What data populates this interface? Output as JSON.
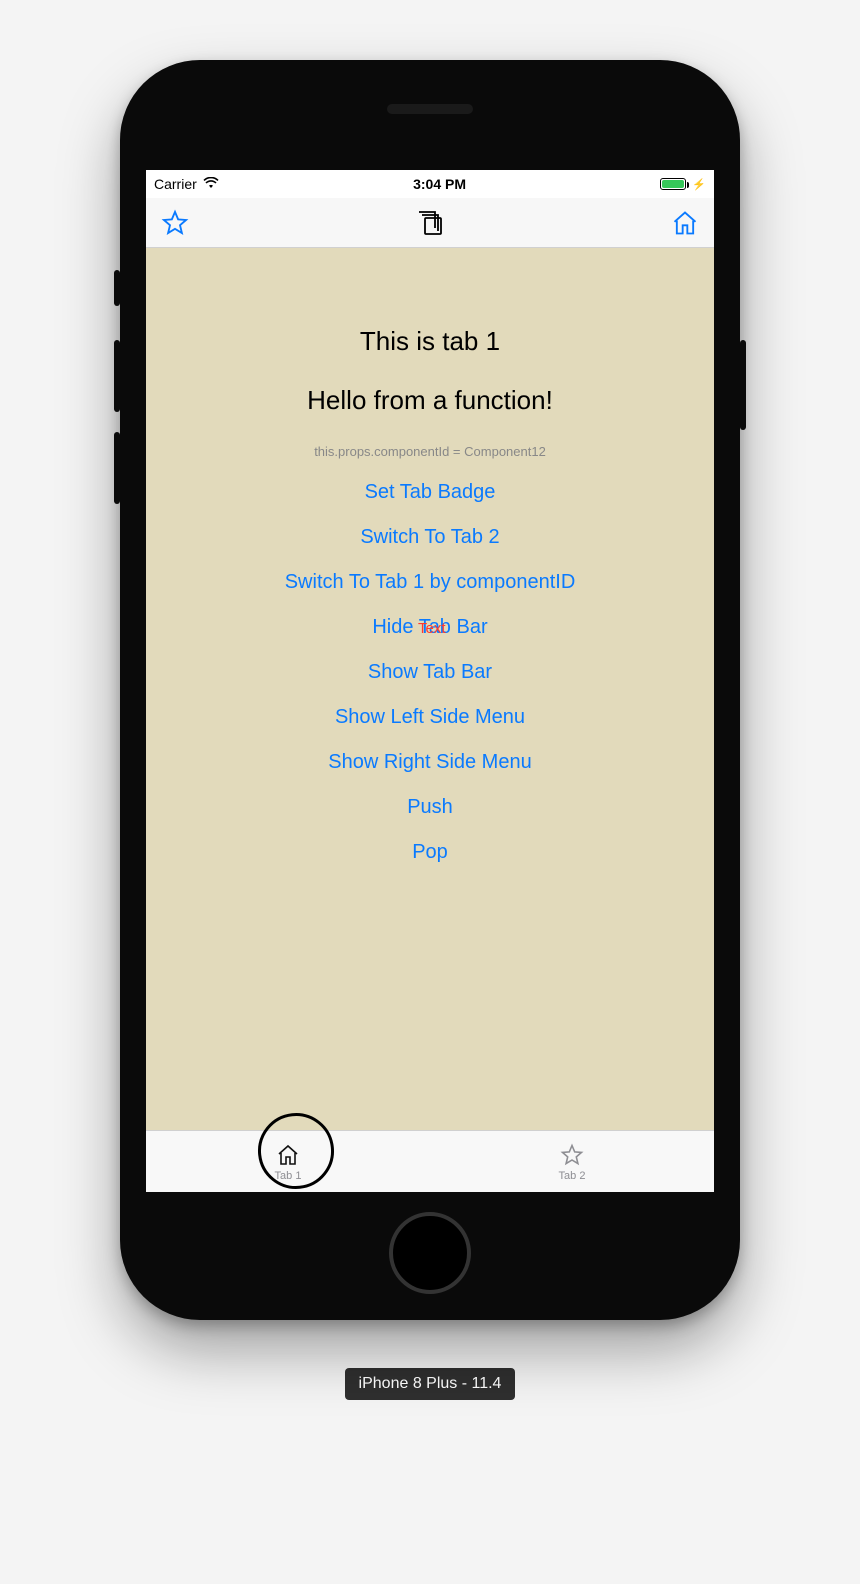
{
  "status": {
    "carrier": "Carrier",
    "time": "3:04 PM"
  },
  "content": {
    "title": "This is tab 1",
    "subtitle": "Hello from a function!",
    "componentId": "this.props.componentId = Component12",
    "overlayText": "Text",
    "links": [
      "Set Tab Badge",
      "Switch To Tab 2",
      "Switch To Tab 1 by componentID",
      "Hide Tab Bar",
      "Show Tab Bar",
      "Show Left Side Menu",
      "Show Right Side Menu",
      "Push",
      "Pop"
    ]
  },
  "tabs": [
    {
      "label": "Tab 1"
    },
    {
      "label": "Tab 2"
    }
  ],
  "simulator": "iPhone 8 Plus - 11.4"
}
